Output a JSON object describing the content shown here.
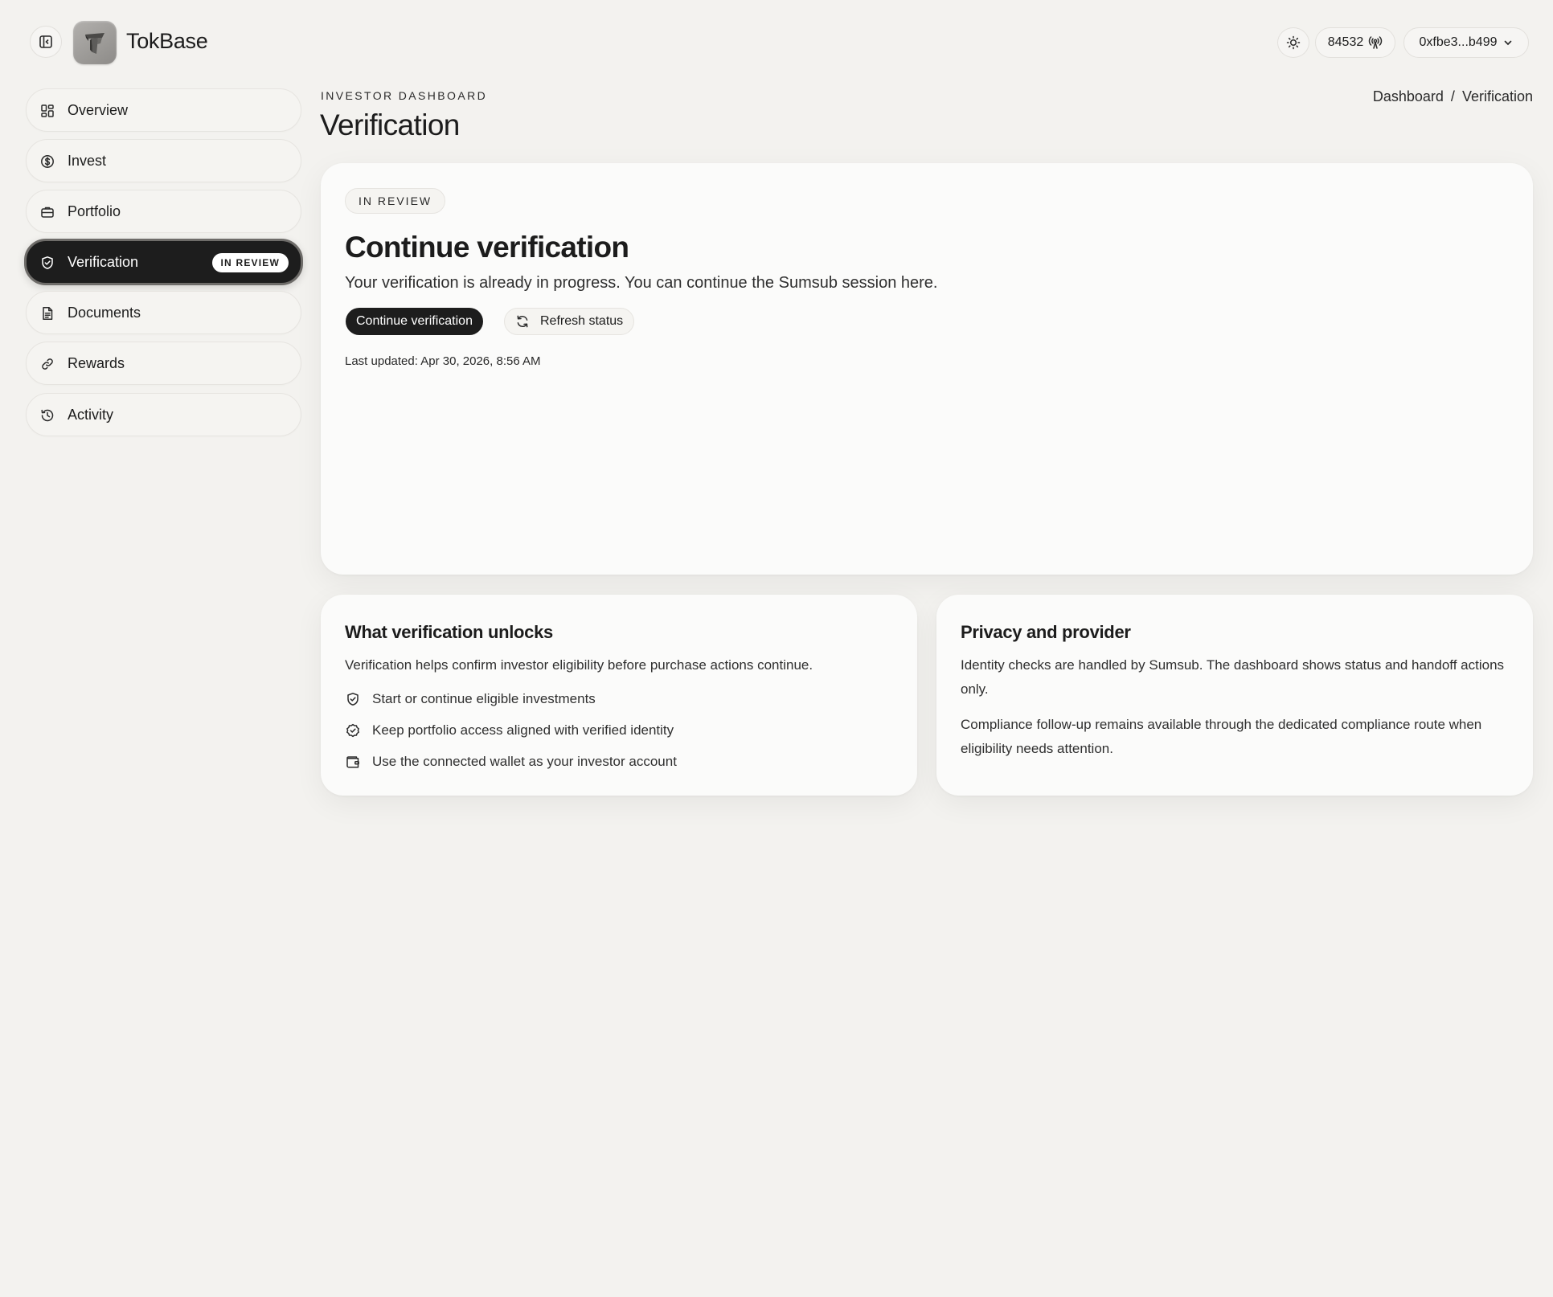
{
  "app": {
    "title": "TokBase"
  },
  "header": {
    "network_id": "84532",
    "wallet_address": "0xfbe3...b499"
  },
  "sidebar": {
    "items": [
      {
        "label": "Overview",
        "icon": "grid-icon"
      },
      {
        "label": "Invest",
        "icon": "dollar-circle-icon"
      },
      {
        "label": "Portfolio",
        "icon": "briefcase-icon"
      },
      {
        "label": "Verification",
        "icon": "shield-check-icon",
        "active": true,
        "badge": "IN REVIEW"
      },
      {
        "label": "Documents",
        "icon": "document-icon"
      },
      {
        "label": "Rewards",
        "icon": "link-icon"
      },
      {
        "label": "Activity",
        "icon": "history-icon"
      }
    ]
  },
  "page": {
    "eyebrow": "INVESTOR DASHBOARD",
    "title": "Verification",
    "breadcrumb": {
      "root": "Dashboard",
      "separator": "/",
      "current": "Verification"
    }
  },
  "verification_card": {
    "status": "IN REVIEW",
    "heading": "Continue verification",
    "description": "Your verification is already in progress. You can continue the Sumsub session here.",
    "primary_button": "Continue verification",
    "secondary_button": "Refresh status",
    "last_updated": "Last updated: Apr 30, 2026, 8:56 AM"
  },
  "unlocks_card": {
    "title": "What verification unlocks",
    "intro": "Verification helps confirm investor eligibility before purchase actions continue.",
    "items": [
      {
        "text": "Start or continue eligible investments",
        "icon": "shield-check-icon"
      },
      {
        "text": "Keep portfolio access aligned with verified identity",
        "icon": "check-circle-icon"
      },
      {
        "text": "Use the connected wallet as your investor account",
        "icon": "wallet-icon"
      }
    ]
  },
  "privacy_card": {
    "title": "Privacy and provider",
    "paragraph1": "Identity checks are handled by Sumsub. The dashboard shows status and handoff actions only.",
    "paragraph2": "Compliance follow-up remains available through the dedicated compliance route when eligibility needs attention."
  },
  "colors": {
    "background": "#f3f2ef",
    "card": "#fbfbfa",
    "accent_dark": "#1d1d1d",
    "text": "#1c1c1c"
  }
}
